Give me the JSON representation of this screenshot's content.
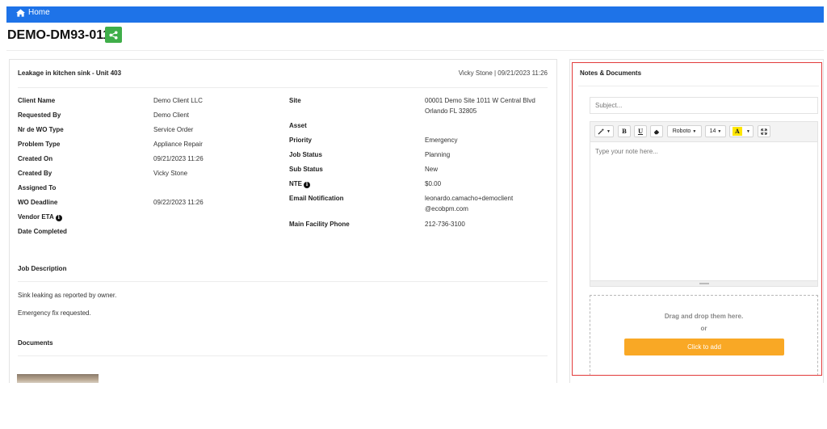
{
  "nav": {
    "home_label": "Home"
  },
  "header": {
    "title": "DEMO-DM93-011"
  },
  "work_order": {
    "heading": "Leakage in kitchen sink - Unit 403",
    "meta": "Vicky Stone | 09/21/2023 11:26",
    "left_fields": [
      {
        "label": "Client Name",
        "value": "Demo Client LLC"
      },
      {
        "label": "Requested By",
        "value": "Demo Client"
      },
      {
        "label": "Nr de WO Type",
        "value": "Service Order"
      },
      {
        "label": "Problem Type",
        "value": "Appliance Repair"
      },
      {
        "label": "Created On",
        "value": "09/21/2023 11:26"
      },
      {
        "label": "Created By",
        "value": "Vicky Stone"
      },
      {
        "label": "Assigned To",
        "value": ""
      },
      {
        "label": "WO Deadline",
        "value": "09/22/2023 11:26"
      },
      {
        "label": "Vendor ETA",
        "value": ""
      },
      {
        "label": "Date Completed",
        "value": ""
      }
    ],
    "right_fields": [
      {
        "label": "Site",
        "value_lines": [
          "00001 Demo Site 1011 W Central Blvd",
          "Orlando FL 32805"
        ]
      },
      {
        "label": "Asset",
        "value_lines": [
          ""
        ]
      },
      {
        "label": "Priority",
        "value_lines": [
          "Emergency"
        ]
      },
      {
        "label": "Job Status",
        "value_lines": [
          "Planning"
        ]
      },
      {
        "label": "Sub Status",
        "value_lines": [
          "New"
        ]
      },
      {
        "label": "NTE",
        "value_lines": [
          "$0.00"
        ]
      },
      {
        "label": "Email Notification",
        "value_lines": [
          "leonardo.camacho+democlient",
          "@ecobpm.com"
        ]
      },
      {
        "label": "Main Facility Phone",
        "value_lines": [
          "212-736-3100"
        ]
      }
    ],
    "job_description_title": "Job Description",
    "job_description_lines": [
      "Sink leaking as reported by owner.",
      "Emergency fix requested."
    ],
    "documents_title": "Documents"
  },
  "notes": {
    "title": "Notes & Documents",
    "subject_placeholder": "Subject...",
    "toolbar": {
      "bold": "B",
      "underline": "U",
      "font": "Roboto",
      "size": "14",
      "highlight": "A"
    },
    "note_placeholder": "Type your note here...",
    "dropzone_text": "Drag and drop them here.",
    "dropzone_or": "or",
    "add_button": "Click to add"
  },
  "colors": {
    "topbar": "#1e73e8",
    "share": "#3fae49",
    "add": "#f9a825",
    "highlight": "#e23b3b"
  }
}
